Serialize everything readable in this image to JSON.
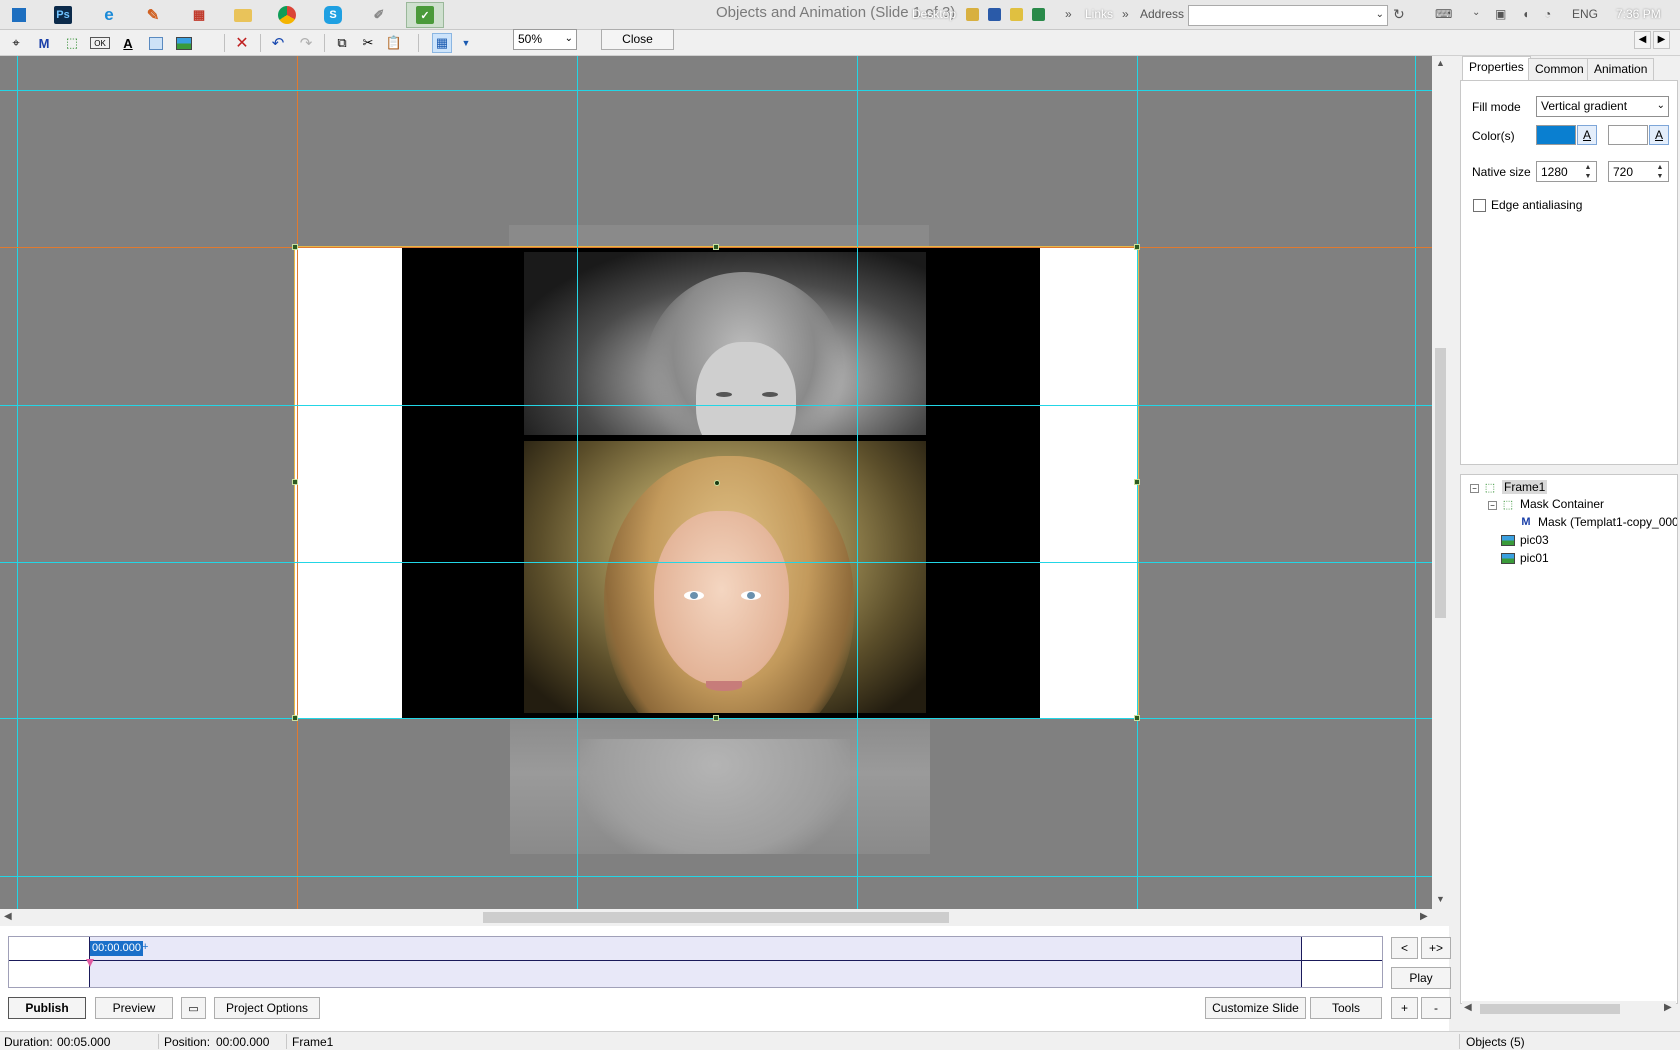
{
  "taskbar": {
    "window_title": "Objects and Animation  (Slide 1 of 3)",
    "desktop_label": "Desktop",
    "links_label": "Links",
    "address_label": "Address",
    "address_value": "",
    "language": "ENG",
    "clock": "7:36 PM",
    "apps": [
      "windows-start-icon",
      "photoshop-icon",
      "internet-explorer-icon",
      "paint-brush-icon",
      "grid-app-icon",
      "file-explorer-icon",
      "chrome-icon",
      "skype-icon",
      "pen-app-icon",
      "slideshow-app-icon"
    ]
  },
  "toolbar": {
    "zoom": "50%",
    "close_label": "Close"
  },
  "properties": {
    "tabs": [
      "Properties",
      "Common",
      "Animation"
    ],
    "fill_mode_label": "Fill mode",
    "fill_mode_value": "Vertical gradient",
    "colors_label": "Color(s)",
    "color1": "#0a7fd0",
    "color2": "#ffffff",
    "color_btn_label": "A",
    "native_size_label": "Native size",
    "native_width": "1280",
    "native_height": "720",
    "edge_antialiasing_label": "Edge antialiasing",
    "edge_antialiasing_checked": false
  },
  "tree": {
    "nodes": [
      {
        "label": "Frame1",
        "icon": "frame-icon",
        "level": 0,
        "selected": true
      },
      {
        "label": "Mask Container",
        "icon": "frame-icon",
        "level": 1,
        "selected": false
      },
      {
        "label": "Mask (Templat1-copy_000",
        "icon": "mask-m-icon",
        "level": 2,
        "selected": false
      },
      {
        "label": "pic03",
        "icon": "picture-icon",
        "level": 1,
        "selected": false
      },
      {
        "label": "pic01",
        "icon": "picture-icon",
        "level": 1,
        "selected": false
      }
    ]
  },
  "timeline": {
    "current_time": "00:00.000",
    "plus": "+",
    "prev_label": "<",
    "fit_label": "+>",
    "play_label": "Play",
    "add_label": "+",
    "remove_label": "-"
  },
  "bottom": {
    "publish": "Publish",
    "preview": "Preview",
    "project_options": "Project Options",
    "customize_slide": "Customize Slide",
    "tools": "Tools"
  },
  "status": {
    "duration_label": "Duration:",
    "duration_value": "00:05.000",
    "position_label": "Position:",
    "position_value": "00:00.000",
    "selected_object": "Frame1",
    "objects_count": "Objects (5)"
  }
}
